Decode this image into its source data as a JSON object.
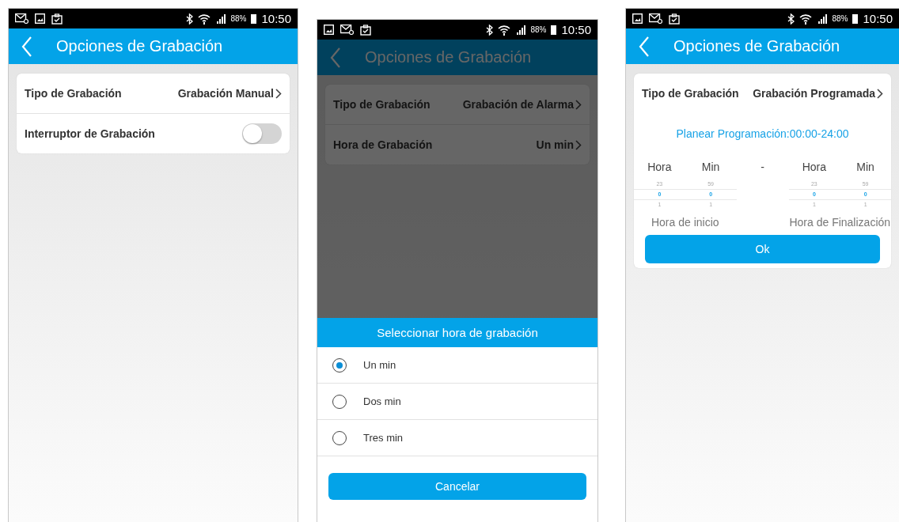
{
  "screens": [
    {
      "status_bar": {
        "notification_icons": [
          {
            "kind": "mail"
          },
          {
            "kind": "image"
          },
          {
            "kind": "clipboard"
          }
        ],
        "battery": "88%",
        "time": "10:50"
      },
      "header": {
        "title": "Opciones de Grabación"
      },
      "dimmed": false,
      "settings": [
        {
          "kind": "link",
          "label": "Tipo de Grabación",
          "value": "Grabación Manual"
        },
        {
          "kind": "toggle",
          "label": "Interruptor de Grabación",
          "on": false
        }
      ]
    },
    {
      "status_bar": {
        "notification_icons": [
          {
            "kind": "image"
          },
          {
            "kind": "mail"
          },
          {
            "kind": "clipboard"
          }
        ],
        "battery": "88%",
        "time": "10:50"
      },
      "header": {
        "title": "Opciones de Grabación"
      },
      "dimmed": true,
      "settings": [
        {
          "kind": "link",
          "label": "Tipo de Grabación",
          "value": "Grabación de Alarma"
        },
        {
          "kind": "link",
          "label": "Hora de Grabación",
          "value": "Un min"
        }
      ],
      "dialog": {
        "title": "Seleccionar hora de grabación",
        "options": [
          {
            "label": "Un min",
            "selected": true
          },
          {
            "label": "Dos min",
            "selected": false
          },
          {
            "label": "Tres min",
            "selected": false
          }
        ],
        "cancel_button": "Cancelar"
      }
    },
    {
      "status_bar": {
        "notification_icons": [
          {
            "kind": "image"
          },
          {
            "kind": "mail"
          },
          {
            "kind": "clipboard"
          }
        ],
        "battery": "88%",
        "time": "10:50"
      },
      "header": {
        "title": "Opciones de Grabación"
      },
      "dimmed": false,
      "settings": [
        {
          "kind": "link",
          "label": "Tipo de Grabación",
          "value": "Grabación Programada"
        }
      ],
      "schedule": {
        "summary": "Planear Programación:00:00-24:00",
        "separator": "-",
        "start": {
          "caption": "Hora de inicio",
          "columns": [
            {
              "label": "Hora",
              "above": "23",
              "current": "0",
              "below": "1"
            },
            {
              "label": "Min",
              "above": "59",
              "current": "0",
              "below": "1"
            }
          ]
        },
        "end": {
          "caption": "Hora de Finalización",
          "columns": [
            {
              "label": "Hora",
              "above": "23",
              "current": "0",
              "below": "1"
            },
            {
              "label": "Min",
              "above": "59",
              "current": "0",
              "below": "1"
            }
          ]
        },
        "ok_button": "Ok"
      }
    }
  ]
}
